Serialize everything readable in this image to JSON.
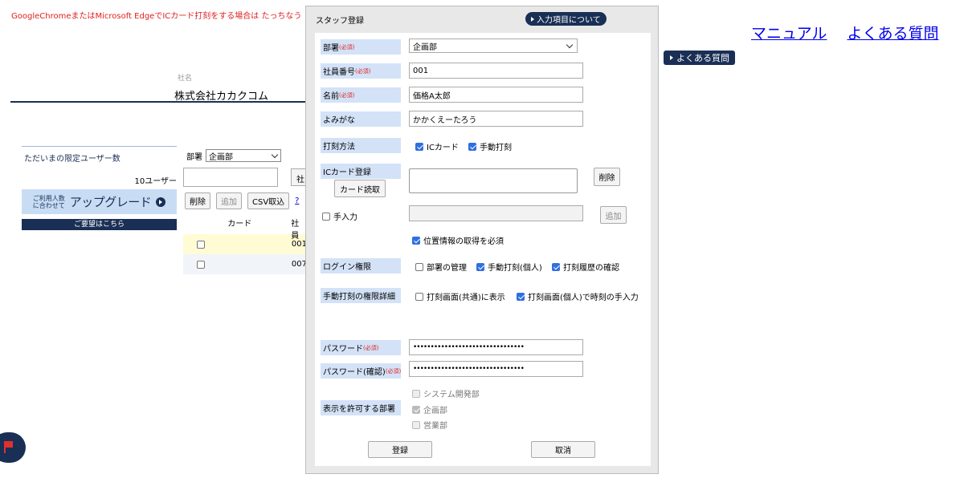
{
  "notice": "GoogleChromeまたはMicrosoft EdgeでICカード打刻をする場合は たっちなう",
  "top_links": [
    "マニュアル",
    "よくある質問"
  ],
  "faq_button": "よくある質問",
  "company": {
    "label": "社名",
    "name": "株式会社カカクコム"
  },
  "limit": {
    "title": "ただいまの限定ユーザー数",
    "count": "10ユーザー",
    "upgrade_small_1": "ご利用人数",
    "upgrade_small_2": "に合わせて",
    "upgrade_main": "アップグレード",
    "request": "ご要望はこちら"
  },
  "staff_list": {
    "dept_label": "部署",
    "dept_value": "企画部",
    "partial_button": "社",
    "buttons": {
      "delete": "削除",
      "add": "追加",
      "csv": "CSV取込",
      "help": "?"
    },
    "columns": [
      "カード",
      "社員"
    ],
    "rows": [
      {
        "id": "001"
      },
      {
        "id": "007"
      }
    ]
  },
  "modal": {
    "title": "スタッフ登録",
    "info_button": "入力項目について",
    "required": "(必須)",
    "dept": {
      "label": "部署",
      "value": "企画部"
    },
    "employee_no": {
      "label": "社員番号",
      "value": "001"
    },
    "name": {
      "label": "名前",
      "value": "価格A太郎"
    },
    "kana": {
      "label": "よみがな",
      "value": "かかくえーたろう"
    },
    "stamp_method": {
      "label": "打刻方法",
      "options": [
        "ICカード",
        "手動打刻"
      ]
    },
    "ic_card": {
      "label": "ICカード登録",
      "read_button": "カード読取",
      "delete_button": "削除"
    },
    "manual_entry": {
      "label": "手入力",
      "add_button": "追加"
    },
    "location": "位置情報の取得を必須",
    "login_rights": {
      "label": "ログイン権限",
      "options": [
        "部署の管理",
        "手動打刻(個人)",
        "打刻履歴の確認"
      ]
    },
    "manual_detail": {
      "label": "手動打刻の権限詳細",
      "options": [
        "打刻画面(共通)に表示",
        "打刻画面(個人)で時刻の手入力"
      ]
    },
    "password": {
      "label": "パスワード",
      "value": "••••••••••••••••••••••••••••••••"
    },
    "password_confirm": {
      "label": "パスワード(確認)",
      "value": "••••••••••••••••••••••••••••••••"
    },
    "visible_depts": {
      "label": "表示を許可する部署",
      "options": [
        "システム開発部",
        "企画部",
        "営業部"
      ]
    },
    "register_button": "登録",
    "cancel_button": "取消"
  }
}
